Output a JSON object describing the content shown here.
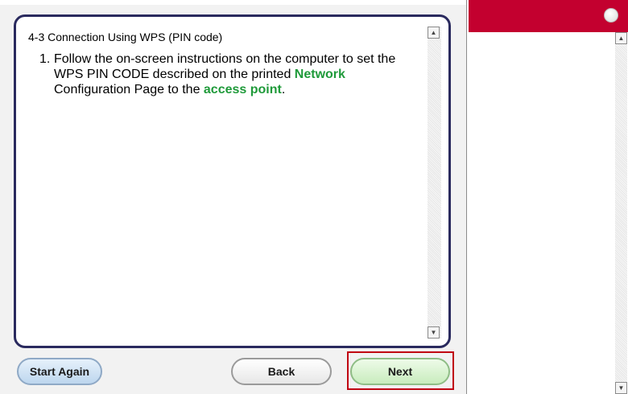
{
  "wizard": {
    "section_title": "4-3 Connection Using WPS (PIN code)",
    "step": {
      "number": "1.",
      "text_1": "Follow the on-screen instructions on the computer to set the WPS PIN CODE described on the printed ",
      "highlight_1": "Network",
      "text_2": " Configuration Page to the ",
      "highlight_2": "access point",
      "text_3": "."
    },
    "buttons": {
      "start_again": "Start Again",
      "back": "Back",
      "next": "Next"
    }
  },
  "scrollbar": {
    "up_glyph": "▲",
    "down_glyph": "▼"
  },
  "colors": {
    "highlight_green": "#1f9a3a",
    "banner_red": "#c3002f",
    "next_focus_red": "#c00012",
    "panel_border": "#2a2a5e"
  }
}
